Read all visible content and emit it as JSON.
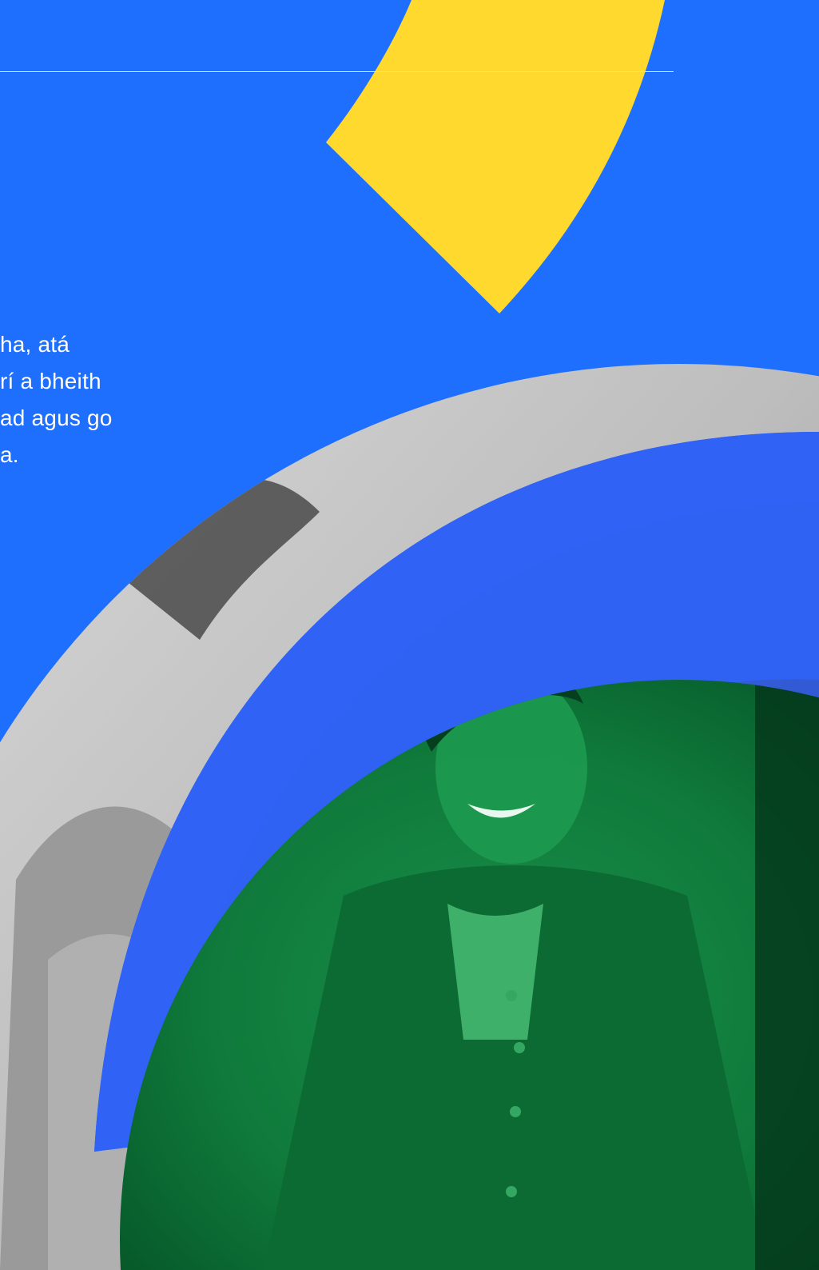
{
  "text_block": {
    "lines": [
      "ha, atá",
      "rí a bheith",
      "ad agus go",
      "a."
    ]
  },
  "colors": {
    "background": "#1f6fff",
    "yellow_shape": "#ffd92e",
    "rule": "#cfdcff",
    "blue_band": "#2f62f5",
    "blue_overlay": "#1948de",
    "green_tint": "#0f7f3e"
  },
  "photo": {
    "description_icon": "photo-icon"
  }
}
